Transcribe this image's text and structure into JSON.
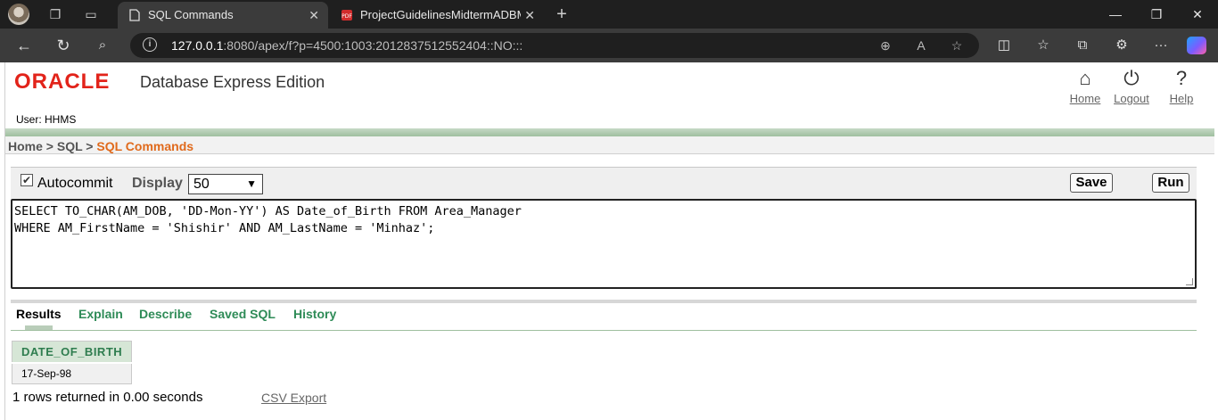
{
  "browser": {
    "tabs": [
      {
        "title": "SQL Commands",
        "active": true
      },
      {
        "title": "ProjectGuidelinesMidtermADBMS",
        "active": false
      }
    ],
    "url_host": "127.0.0.1",
    "url_rest": ":8080/apex/f?p=4500:1003:2012837512552404::NO:::",
    "icons": [
      "profile-avatar",
      "workspaces-icon",
      "tab-actions-icon",
      "new-tab-icon",
      "back-icon",
      "refresh-icon",
      "search-icon",
      "zoom-icon",
      "read-aloud-icon",
      "favorite-icon",
      "split-screen-icon",
      "favorites-icon",
      "collections-icon",
      "extensions-icon",
      "more-icon",
      "copilot-icon"
    ]
  },
  "header": {
    "brand": "ORACLE",
    "product": "Database Express Edition",
    "user": "User: HHMS",
    "links": [
      {
        "label": "Home",
        "icon": "home-icon"
      },
      {
        "label": "Logout",
        "icon": "power-icon"
      },
      {
        "label": "Help",
        "icon": "help-icon"
      }
    ]
  },
  "breadcrumb": {
    "home": "Home",
    "sep1": ">",
    "sql": "SQL",
    "sep2": ">",
    "current": "SQL Commands"
  },
  "commandbar": {
    "autocommit_label": "Autocommit",
    "autocommit_checked": true,
    "display_label": "Display",
    "display_value": "50",
    "save_label": "Save",
    "run_label": "Run"
  },
  "editor": {
    "line1": "SELECT TO_CHAR(AM_DOB, 'DD-Mon-YY') AS Date_of_Birth FROM Area_Manager",
    "line2": "WHERE AM_FirstName = 'Shishir' AND AM_LastName = 'Minhaz';"
  },
  "result_tabs": [
    "Results",
    "Explain",
    "Describe",
    "Saved SQL",
    "History"
  ],
  "results": {
    "columns": [
      "DATE_OF_BIRTH"
    ],
    "rows": [
      [
        "17-Sep-98"
      ]
    ],
    "status": "1 rows returned in 0.00 seconds",
    "export_label": "CSV Export"
  },
  "colors": {
    "oracle_red": "#e2231a",
    "breadcrumb_current": "#e06a1c",
    "tab_green": "#2e8b57"
  }
}
